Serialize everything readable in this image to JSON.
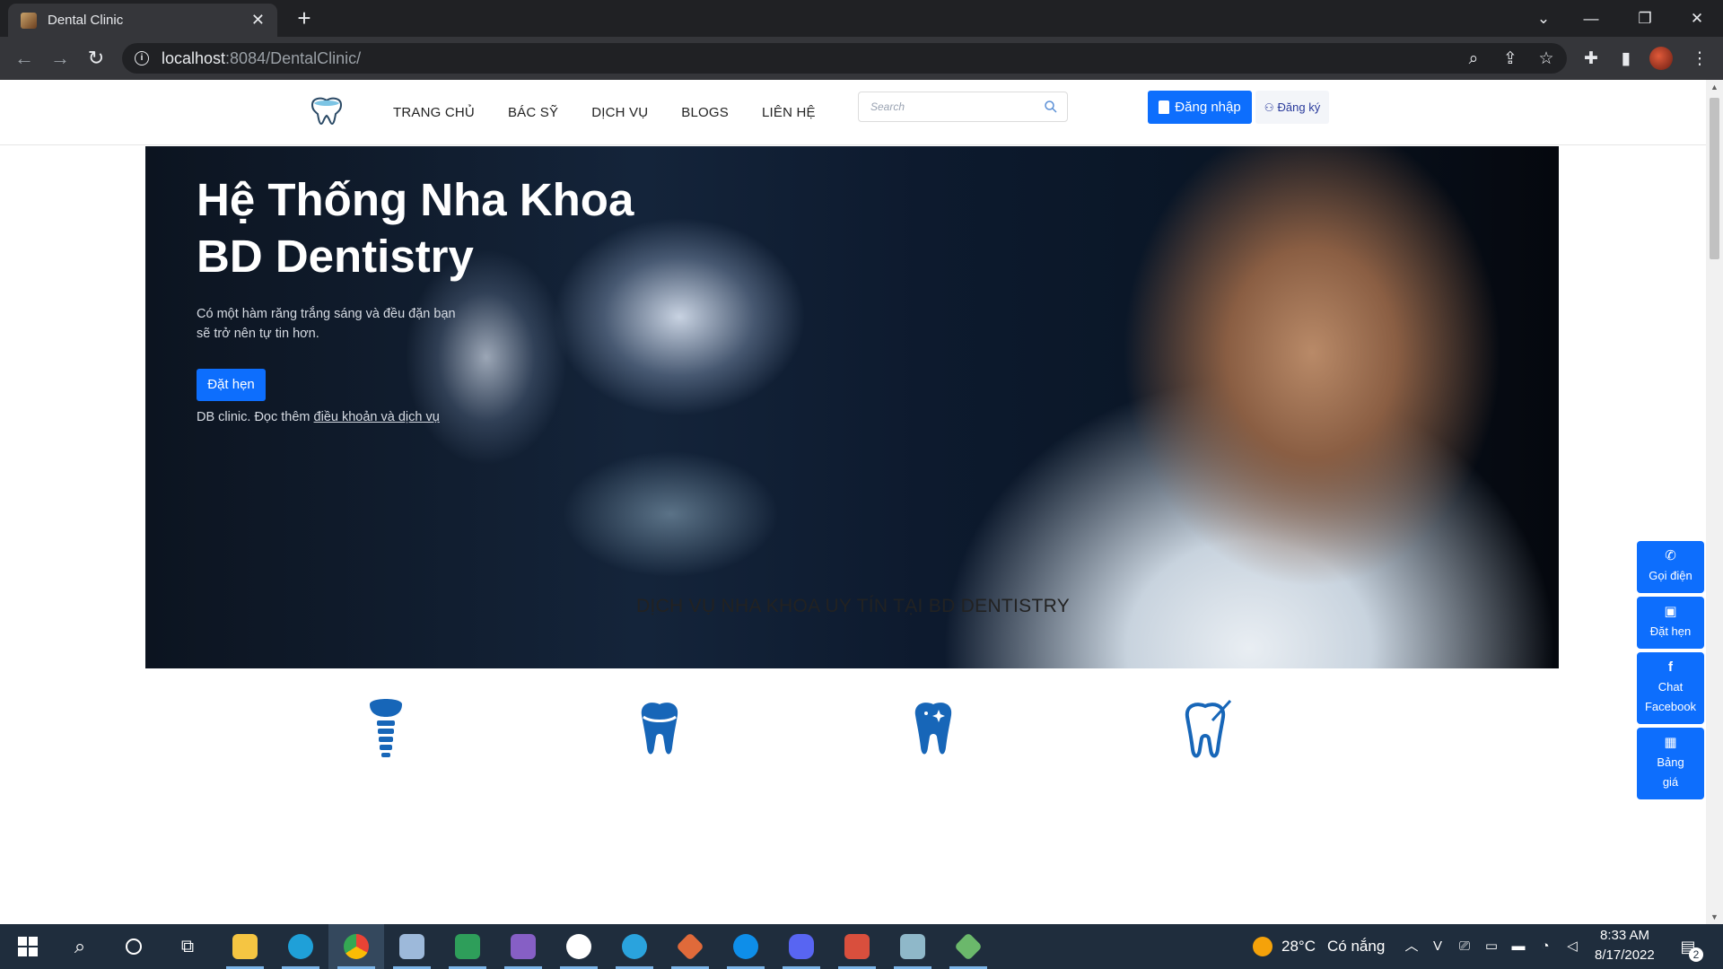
{
  "browser": {
    "tab_title": "Dental Clinic",
    "url_host": "localhost",
    "url_rest": ":8084/DentalClinic/"
  },
  "header": {
    "nav": [
      "TRANG CHỦ",
      "BÁC SỸ",
      "DỊCH VỤ",
      "BLOGS",
      "LIÊN HỆ"
    ],
    "search_placeholder": "Search",
    "login_label": "Đăng nhập",
    "register_label": "Đăng ký"
  },
  "hero": {
    "title_line1": "Hệ Thống Nha Khoa",
    "title_line2": "BD Dentistry",
    "subtitle": "Có một hàm răng trắng sáng và đều đặn bạn sẽ trở nên tự tin hơn.",
    "book_label": "Đặt hẹn",
    "terms_prefix": "DB clinic. Đọc thêm ",
    "terms_link": "điều khoản và dịch vụ"
  },
  "services": {
    "heading": "DỊCH VỤ NHA KHOA UY TÍN TẠI BD DENTISTRY",
    "icons": [
      "dental-implant-icon",
      "dental-crown-icon",
      "whitening-tooth-icon",
      "braces-tooth-icon"
    ]
  },
  "floating": [
    {
      "glyph": "phone-icon",
      "label": "Gọi điện"
    },
    {
      "glyph": "calendar-icon",
      "label": "Đặt hẹn"
    },
    {
      "glyph": "facebook-icon",
      "label": "Chat Facebook"
    },
    {
      "glyph": "table-icon",
      "label": "Bảng giá"
    }
  ],
  "taskbar": {
    "temperature": "28°C",
    "weather": "Có nắng",
    "time": "8:33 AM",
    "date": "8/17/2022",
    "notification_count": "2"
  },
  "colors": {
    "primary": "#0d6efd",
    "service_icon": "#1766b8",
    "taskbar": "#1f2d3d"
  }
}
